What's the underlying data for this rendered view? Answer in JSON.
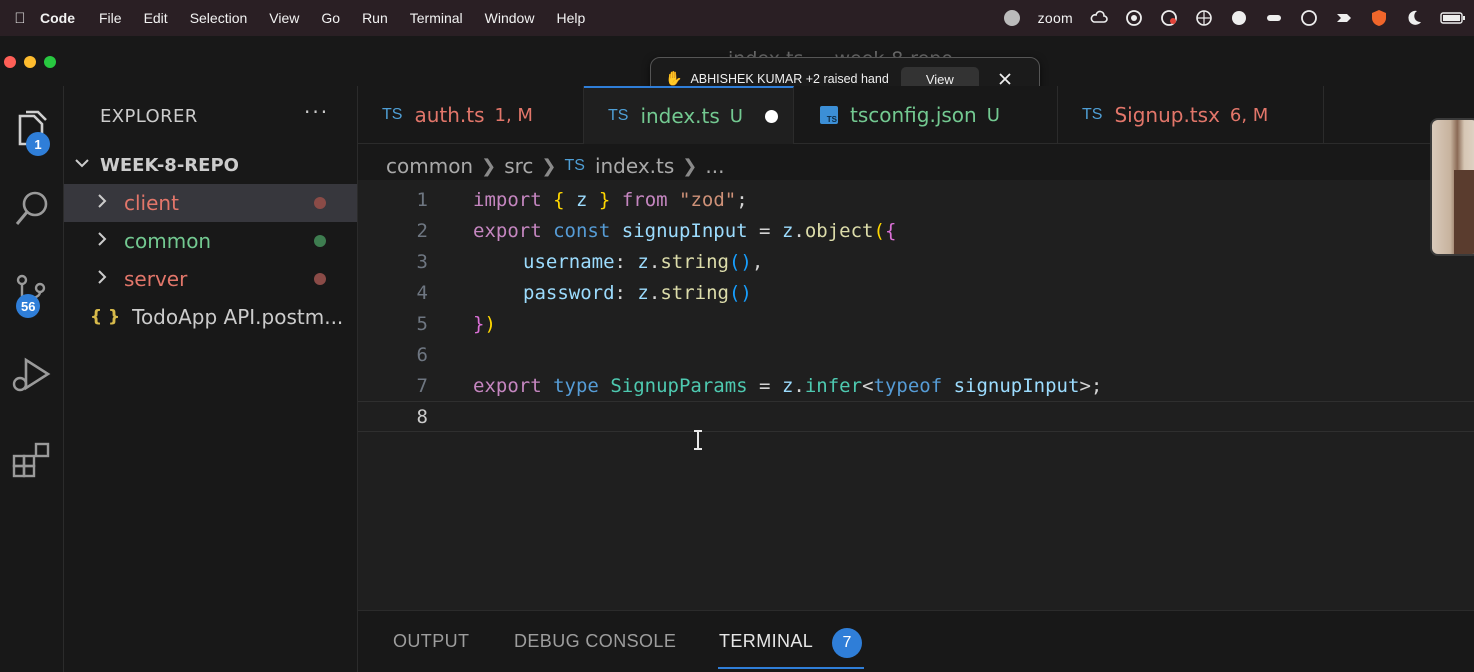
{
  "menubar": {
    "app": "Code",
    "items": [
      "File",
      "Edit",
      "Selection",
      "View",
      "Go",
      "Run",
      "Terminal",
      "Window",
      "Help"
    ],
    "zoom_label": "zoom"
  },
  "window": {
    "title": "index.ts — week-8-repo"
  },
  "notification": {
    "message": "ABHISHEK KUMAR +2 raised hand",
    "view_label": "View"
  },
  "activity": {
    "explorer_badge": "1",
    "scm_badge": "56"
  },
  "sidebar": {
    "header": "EXPLORER",
    "more": "···",
    "repo": "WEEK-8-REPO",
    "items": [
      {
        "label": "client",
        "color": "#e2766a",
        "dot": "#8a4b47"
      },
      {
        "label": "common",
        "color": "#73c991",
        "dot": "#3e7d50"
      },
      {
        "label": "server",
        "color": "#e2766a",
        "dot": "#8a4b47"
      }
    ],
    "file": {
      "brace": "{ }",
      "label": "TodoApp API.postm..."
    }
  },
  "tabs": [
    {
      "badge": "TS",
      "name": "auth.ts",
      "status": "1, M",
      "color": "#e2766a"
    },
    {
      "badge": "TS",
      "name": "index.ts",
      "status": "U",
      "color": "#73c991"
    },
    {
      "name": "tsconfig.json",
      "status": "U",
      "color": "#73c991"
    },
    {
      "badge": "TS",
      "name": "Signup.tsx",
      "status": "6, M",
      "color": "#e2766a"
    }
  ],
  "breadcrumb": {
    "part1": "common",
    "part2": "src",
    "badge": "TS",
    "file": "index.ts",
    "more": "..."
  },
  "code": {
    "line_numbers": [
      "1",
      "2",
      "3",
      "4",
      "5",
      "6",
      "7",
      "8"
    ],
    "l1": {
      "k1": "import",
      "b1": "{",
      "v": "z",
      "b2": "}",
      "k2": "from",
      "s": "\"zod\"",
      "p": ";"
    },
    "l2": {
      "k1": "export",
      "k2": "const",
      "v": "signupInput",
      "eq": "=",
      "z": "z",
      "dot": ".",
      "fn": "object",
      "b1": "(",
      "b2": "{"
    },
    "l3": {
      "prop": "username",
      "colon": ":",
      "z": "z",
      "dot": ".",
      "fn": "string",
      "par": "()",
      "comma": ","
    },
    "l4": {
      "prop": "password",
      "colon": ":",
      "z": "z",
      "dot": ".",
      "fn": "string",
      "par": "()"
    },
    "l5": {
      "b1": "}",
      "b2": ")"
    },
    "l7": {
      "k1": "export",
      "k2": "type",
      "t": "SignupParams",
      "eq": "=",
      "z": "z",
      "dot": ".",
      "t2": "infer",
      "lt": "<",
      "k3": "typeof",
      "v": "signupInput",
      "gt": ">",
      "semi": ";"
    }
  },
  "panel": {
    "tabs": [
      "OUTPUT",
      "DEBUG CONSOLE",
      "TERMINAL"
    ],
    "terminal_badge": "7"
  }
}
